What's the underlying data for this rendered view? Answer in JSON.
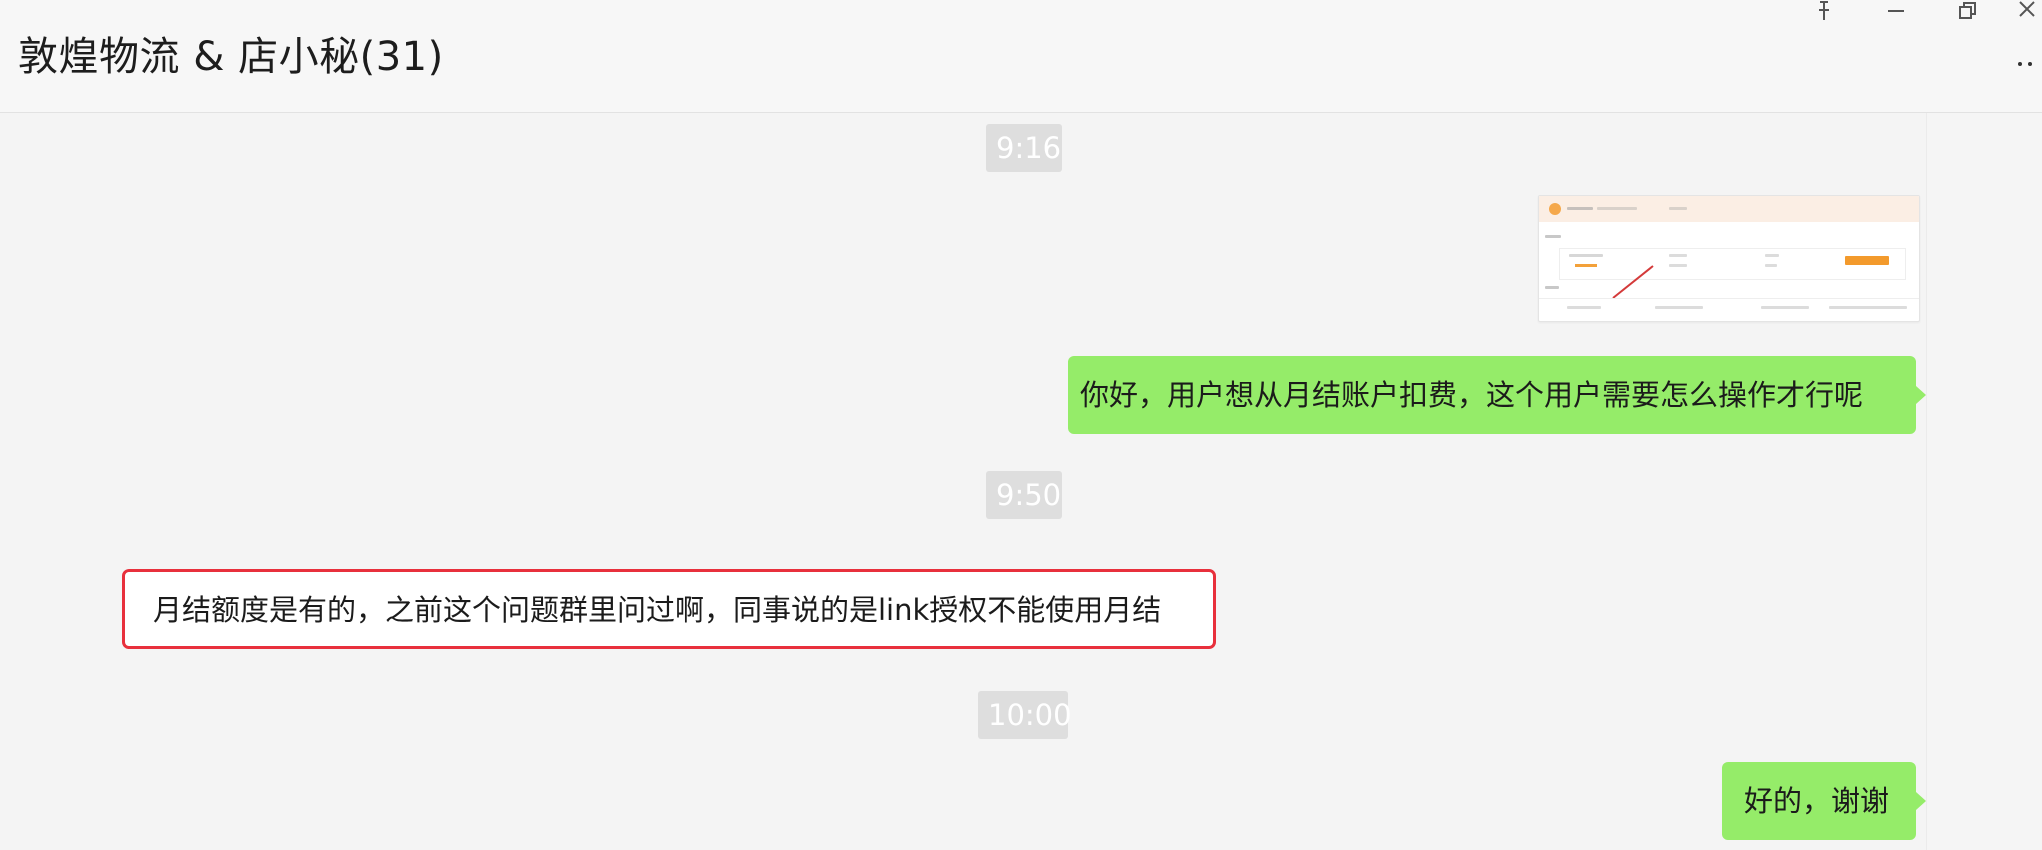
{
  "window": {
    "title": "敦煌物流 & 店小秘(31)"
  },
  "icons": {
    "pin": "pin-icon",
    "minimize": "minimize-icon",
    "restore": "restore-icon",
    "close": "close-icon",
    "more": "more-icon"
  },
  "messages": [
    {
      "type": "time",
      "text": "9:16"
    },
    {
      "type": "image",
      "sender": "self"
    },
    {
      "type": "text",
      "sender": "self",
      "text": "你好，用户想从月结账户扣费，这个用户需要怎么操作才行呢"
    },
    {
      "type": "time",
      "text": "9:50"
    },
    {
      "type": "text",
      "sender": "other",
      "highlighted": true,
      "text": "月结额度是有的，之前这个问题群里问过啊，同事说的是link授权不能使用月结"
    },
    {
      "type": "time",
      "text": "10:00"
    },
    {
      "type": "text",
      "sender": "self",
      "text": "好的，谢谢"
    }
  ],
  "colors": {
    "self_bubble": "#95ec69",
    "other_bubble": "#ffffff",
    "highlight_border": "#e8303c",
    "timestamp_bg": "#dedede",
    "background": "#f4f4f4"
  }
}
